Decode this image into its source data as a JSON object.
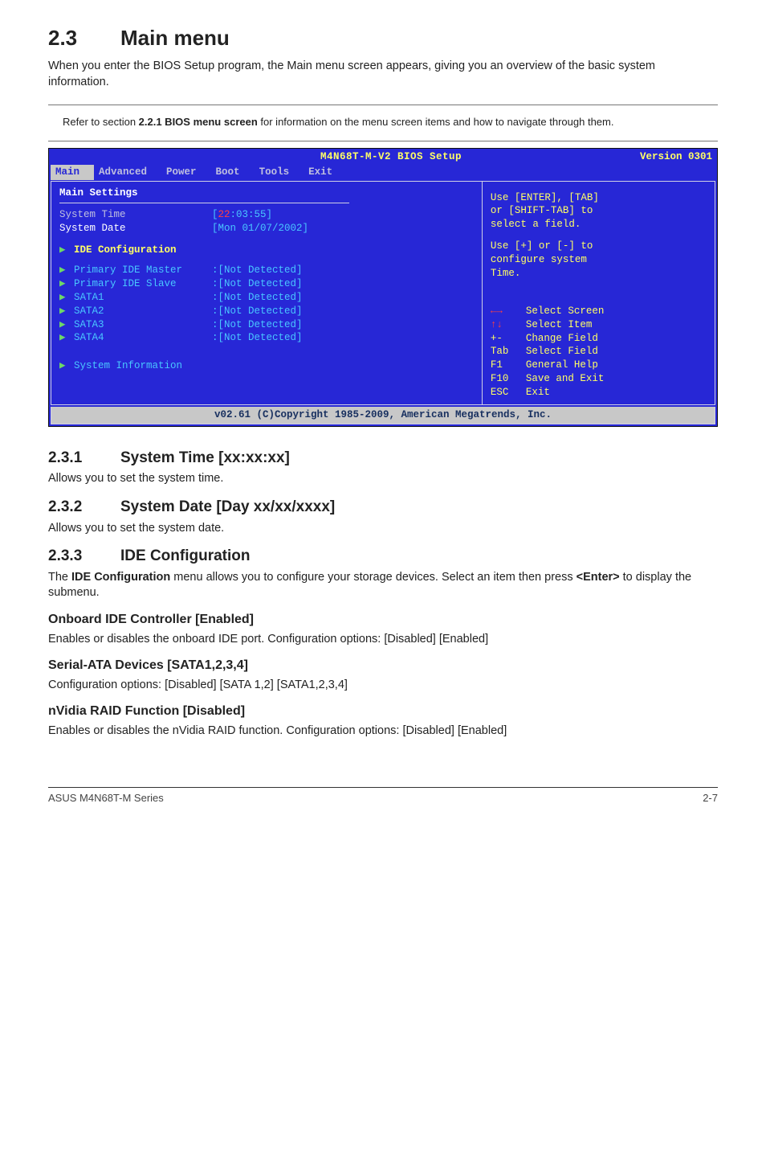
{
  "section": {
    "number": "2.3",
    "title": "Main menu"
  },
  "intro": "When you enter the BIOS Setup program, the Main menu screen appears, giving you an overview of the basic system information.",
  "note": {
    "text_a": "Refer to section ",
    "bold": "2.2.1 BIOS menu screen",
    "text_b": " for information on the menu screen items and how to navigate through them."
  },
  "bios": {
    "title": "M4N68T-M-V2 BIOS Setup",
    "version": "Version 0301",
    "tabs": [
      "Main",
      "Advanced",
      "Power",
      "Boot",
      "Tools",
      "Exit"
    ],
    "heading": "Main Settings",
    "time_label": "System Time",
    "time_hh": "22",
    "time_rest": ":03:55",
    "date_label": "System Date",
    "date_val": "[Mon 01/07/2002]",
    "ide_conf": "IDE Configuration",
    "rows": [
      {
        "label": "Primary IDE Master",
        "val": ":[Not Detected]"
      },
      {
        "label": "Primary IDE Slave",
        "val": ":[Not Detected]"
      },
      {
        "label": "SATA1",
        "val": ":[Not Detected]"
      },
      {
        "label": "SATA2",
        "val": ":[Not Detected]"
      },
      {
        "label": "SATA3",
        "val": ":[Not Detected]"
      },
      {
        "label": "SATA4",
        "val": ":[Not Detected]"
      }
    ],
    "sysinfo": "System Information",
    "help1": "Use [ENTER], [TAB]",
    "help2": "or [SHIFT-TAB] to",
    "help3": "select a field.",
    "help4": "Use [+] or [-] to",
    "help5": "configure system",
    "help6": "Time.",
    "legend": [
      {
        "key": "←→",
        "text": "Select Screen"
      },
      {
        "key": "↑↓",
        "text": "Select Item"
      },
      {
        "key": "+-",
        "text": "Change Field"
      },
      {
        "key": "Tab",
        "text": "Select Field"
      },
      {
        "key": "F1",
        "text": "General Help"
      },
      {
        "key": "F10",
        "text": "Save and Exit"
      },
      {
        "key": "ESC",
        "text": "Exit"
      }
    ],
    "footer": "v02.61 (C)Copyright 1985-2009, American Megatrends, Inc."
  },
  "s231": {
    "num": "2.3.1",
    "title": "System Time [xx:xx:xx]",
    "body": "Allows you to set the system time."
  },
  "s232": {
    "num": "2.3.2",
    "title": "System Date [Day xx/xx/xxxx]",
    "body": "Allows you to set the system date."
  },
  "s233": {
    "num": "2.3.3",
    "title": "IDE Configuration",
    "body_a": "The ",
    "body_bold": "IDE Configuration",
    "body_b": " menu allows you to configure your storage devices. Select an item then press ",
    "enter": "<Enter>",
    "body_c": " to display the submenu."
  },
  "h_onboard": "Onboard IDE Controller [Enabled]",
  "p_onboard": "Enables or disables the onboard IDE port. Configuration options: [Disabled] [Enabled]",
  "h_serial": "Serial-ATA Devices [SATA1,2,3,4]",
  "p_serial": "Configuration options: [Disabled] [SATA 1,2] [SATA1,2,3,4]",
  "h_nvidia": "nVidia RAID Function [Disabled]",
  "p_nvidia": "Enables or disables the nVidia RAID function. Configuration options: [Disabled] [Enabled]",
  "footer_left": "ASUS M4N68T-M Series",
  "footer_right": "2-7"
}
